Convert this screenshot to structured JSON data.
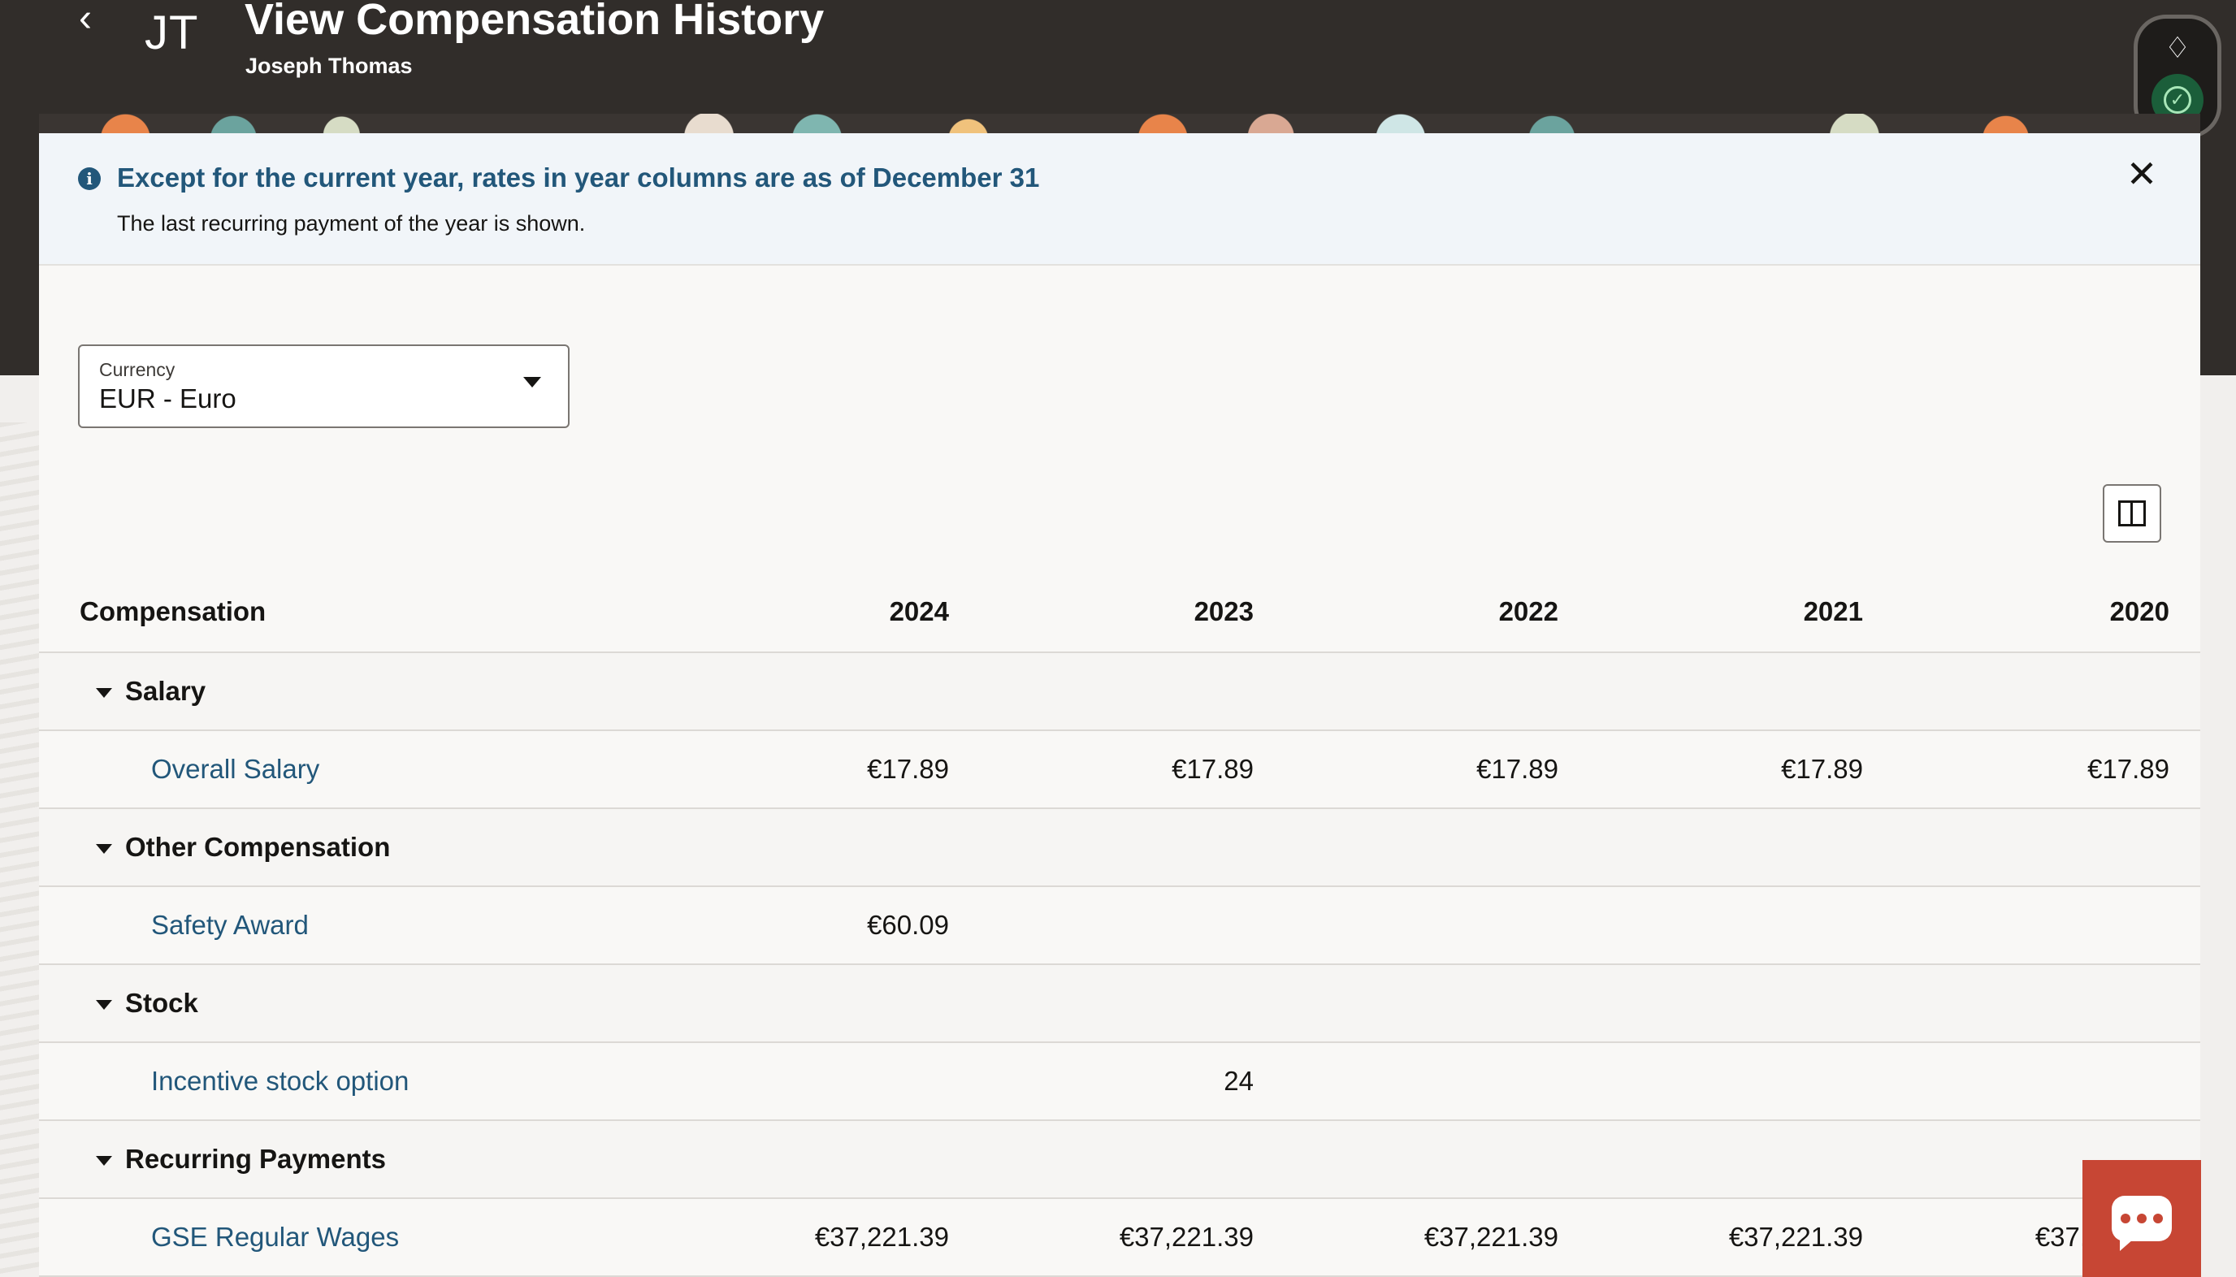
{
  "header": {
    "back_icon": "chevron-left-icon",
    "avatar_initials": "JT",
    "title": "View Compensation History",
    "subtitle": "Joseph Thomas"
  },
  "assistant": {
    "top_icon": "assistant-logo-icon",
    "status_icon": "check-circle-icon",
    "status_color": "#1b5e3a"
  },
  "info_banner": {
    "icon": "info-icon",
    "title": "Except for the current year, rates in year columns are as of December 31",
    "text": "The last recurring payment of the year is shown.",
    "close_icon": "close-icon"
  },
  "currency": {
    "label": "Currency",
    "value": "EUR - Euro"
  },
  "table": {
    "columns_icon": "columns-icon",
    "headers": {
      "compensation": "Compensation",
      "y2024": "2024",
      "y2023": "2023",
      "y2022": "2022",
      "y2021": "2021",
      "y2020": "2020"
    },
    "groups": {
      "salary": {
        "label": "Salary",
        "items": [
          {
            "name": "Overall Salary",
            "y2024": "€17.89",
            "y2023": "€17.89",
            "y2022": "€17.89",
            "y2021": "€17.89",
            "y2020": "€17.89"
          }
        ]
      },
      "other": {
        "label": "Other Compensation",
        "items": [
          {
            "name": "Safety Award",
            "y2024": "€60.09",
            "y2023": "",
            "y2022": "",
            "y2021": "",
            "y2020": ""
          }
        ]
      },
      "stock": {
        "label": "Stock",
        "items": [
          {
            "name": "Incentive stock option",
            "y2024": "",
            "y2023": "24",
            "y2022": "",
            "y2021": "",
            "y2020": ""
          }
        ]
      },
      "recurring": {
        "label": "Recurring Payments",
        "items": [
          {
            "name": "GSE Regular Wages",
            "y2024": "€37,221.39",
            "y2023": "€37,221.39",
            "y2022": "€37,221.39",
            "y2021": "€37,221.39",
            "y2020": "€37,221.39"
          }
        ]
      }
    }
  },
  "chat": {
    "icon": "chat-icon",
    "color": "#c74634"
  },
  "colors": {
    "header_bg": "#312d2a",
    "link": "#22577a",
    "info_bg": "#f1f5f9"
  }
}
